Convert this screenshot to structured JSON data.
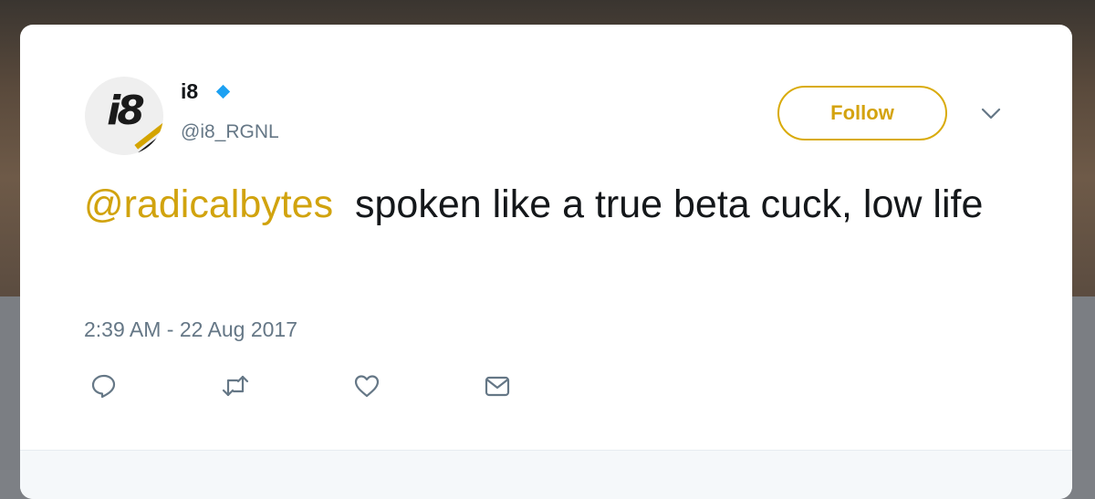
{
  "tweet": {
    "display_name": "i8",
    "handle": "@i8_RGNL",
    "avatar_text": "i8",
    "follow_label": "Follow",
    "mention": "@radicalbytes",
    "text": "spoken like a true beta cuck, low life",
    "timestamp": "2:39 AM - 22 Aug 2017"
  },
  "icons": {
    "verified": "verified-diamond-icon",
    "menu": "chevron-down-icon",
    "reply": "reply-icon",
    "retweet": "retweet-icon",
    "like": "heart-icon",
    "dm": "envelope-icon"
  },
  "colors": {
    "accent": "#d4a30e",
    "verified": "#1da1f2",
    "secondary_text": "#657786",
    "primary_text": "#14171a"
  }
}
